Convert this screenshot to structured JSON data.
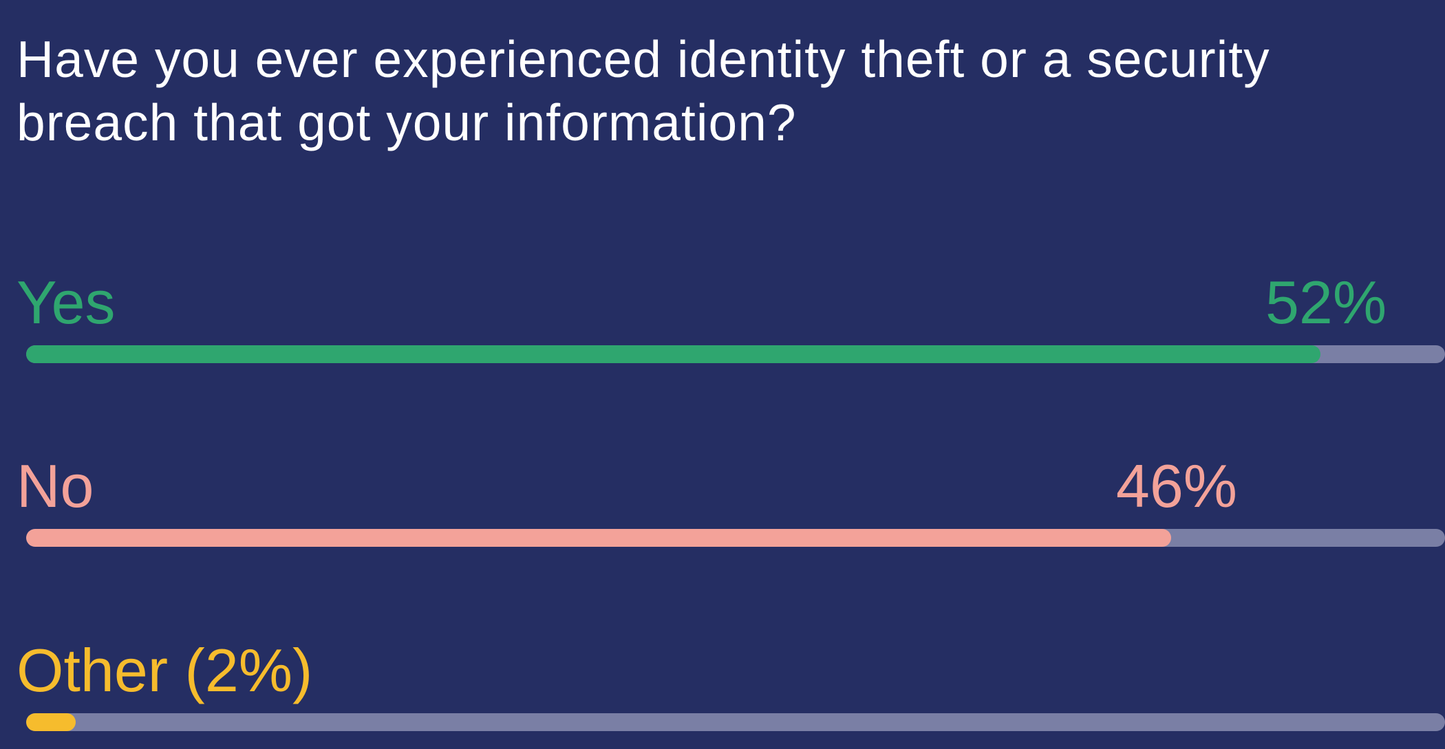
{
  "question": "Have you ever experienced identity theft or a security breach that got your information?",
  "colors": {
    "background": "#252e63",
    "track": "#7a7fa5",
    "yes": "#2fa66f",
    "no": "#f3a299",
    "other": "#f6bc2d",
    "title": "#ffffff"
  },
  "chart_data": {
    "type": "bar",
    "orientation": "horizontal",
    "title": "Have you ever experienced identity theft or a security breach that got your information?",
    "categories": [
      "Yes",
      "No",
      "Other"
    ],
    "values": [
      52,
      46,
      2
    ],
    "unit": "%",
    "xlim": [
      0,
      57
    ],
    "rows": [
      {
        "key": "yes",
        "label": "Yes",
        "value": 52,
        "value_label": "52%"
      },
      {
        "key": "no",
        "label": "No",
        "value": 46,
        "value_label": "46%"
      },
      {
        "key": "other",
        "label": "Other (2%)",
        "value": 2,
        "value_label": ""
      }
    ]
  }
}
